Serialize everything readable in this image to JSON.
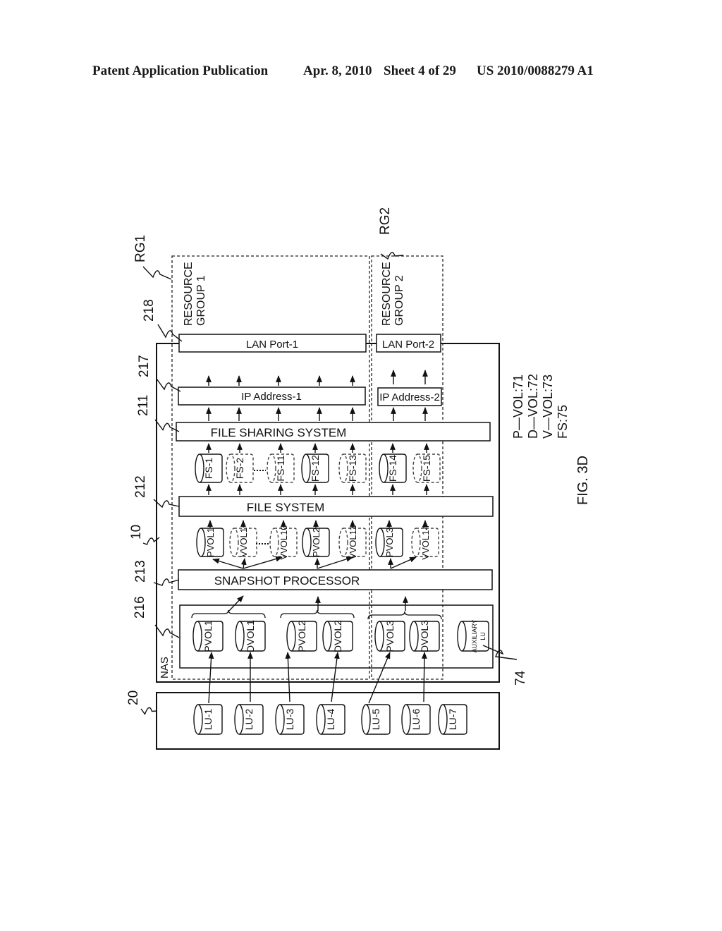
{
  "header": {
    "publication": "Patent Application Publication",
    "date": "Apr. 8, 2010",
    "sheet": "Sheet 4 of 29",
    "number": "US 2010/0088279 A1"
  },
  "figure": {
    "caption": "FIG. 3D",
    "legend": [
      "P—VOL:71",
      "D—VOL:72",
      "V—VOL:73",
      "FS:75"
    ],
    "refs": {
      "rg1": "RG1",
      "rg2": "RG2",
      "r218": "218",
      "r217": "217",
      "r211": "211",
      "r212": "212",
      "r10": "10",
      "r213": "213",
      "r216": "216",
      "r20": "20",
      "r74": "74"
    },
    "groups": {
      "rg1_label": [
        "RESOURCE",
        "GROUP 1"
      ],
      "rg2_label": [
        "RESOURCE",
        "GROUP 2"
      ]
    },
    "nas_label": "NAS",
    "blocks": {
      "lan1": "LAN Port-1",
      "lan2": "LAN Port-2",
      "ip1": "IP Address-1",
      "ip2": "IP Address-2",
      "fss": "FILE SHARING SYSTEM",
      "fs": "FILE SYSTEM",
      "snap": "SNAPSHOT PROCESSOR"
    },
    "file_systems": [
      {
        "label": "FS-1",
        "style": "solid"
      },
      {
        "label": "FS-2",
        "style": "dashed"
      },
      {
        "label": "FS-11",
        "style": "dashed"
      },
      {
        "label": "FS-12",
        "style": "solid"
      },
      {
        "label": "FS-13",
        "style": "dashed"
      },
      {
        "label": "FS-14",
        "style": "solid"
      },
      {
        "label": "FS-15",
        "style": "dashed"
      }
    ],
    "volumes": [
      {
        "label": "PVOL1",
        "style": "solid"
      },
      {
        "label": "VVOL1",
        "style": "dashed"
      },
      {
        "label": "VVOL10",
        "style": "dashed"
      },
      {
        "label": "PVOL2",
        "style": "solid"
      },
      {
        "label": "VVOL11",
        "style": "dashed"
      },
      {
        "label": "PVOL3",
        "style": "solid"
      },
      {
        "label": "VVOL14",
        "style": "dashed"
      }
    ],
    "nas_volumes": [
      "PVOL1",
      "DVOL1",
      "PVOL2",
      "DVOL2",
      "PVOL3",
      "DVOL3"
    ],
    "auxiliary_lu": [
      "AUXILIARY",
      "LU"
    ],
    "storage_lus": [
      "LU-1",
      "LU-2",
      "LU-3",
      "LU-4",
      "LU-5",
      "LU-6",
      "LU-7"
    ]
  }
}
